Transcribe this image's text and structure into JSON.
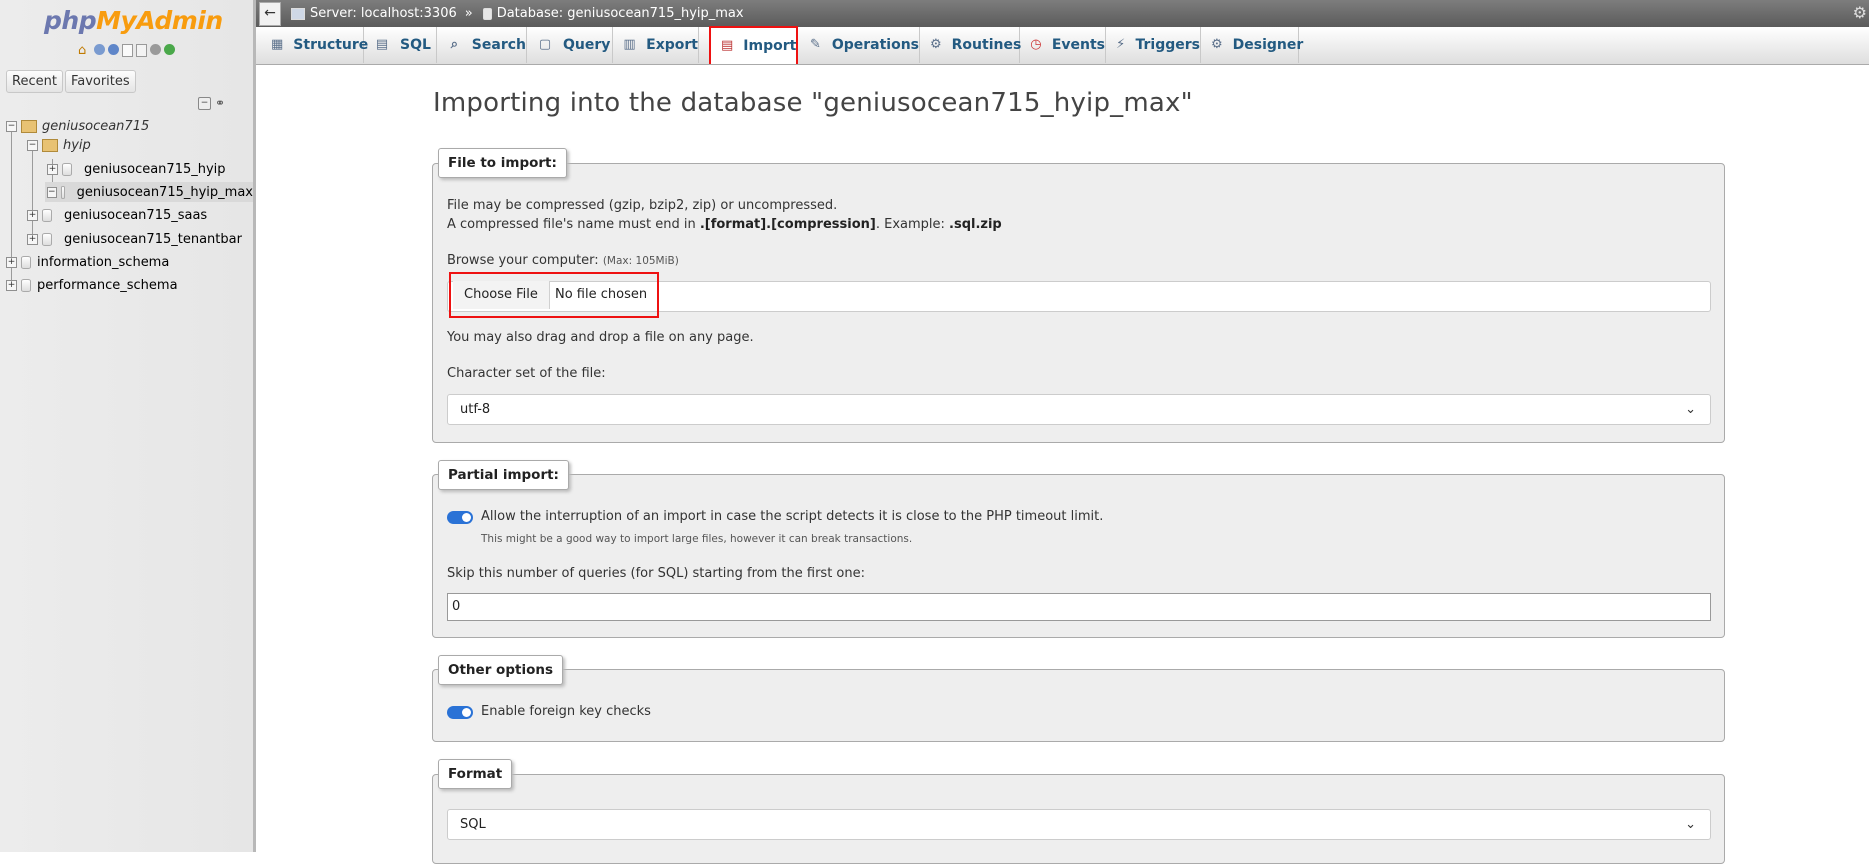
{
  "sidebar": {
    "logo_php": "php",
    "logo_myadmin": "MyAdmin",
    "tabs": [
      "Recent",
      "Favorites"
    ],
    "tree": [
      {
        "label": "geniusocean715",
        "italic": true
      },
      {
        "label": "hyip",
        "italic": true
      },
      {
        "label": "geniusocean715_hyip"
      },
      {
        "label": "geniusocean715_hyip_max"
      },
      {
        "label": "geniusocean715_saas"
      },
      {
        "label": "geniusocean715_tenantbar"
      },
      {
        "label": "information_schema"
      },
      {
        "label": "performance_schema"
      }
    ]
  },
  "topbar": {
    "server": "Server: localhost:3306",
    "separator": "»",
    "database": "Database: geniusocean715_hyip_max"
  },
  "tabs": [
    {
      "label": "Structure",
      "icon": "structure-icon"
    },
    {
      "label": "SQL",
      "icon": "sql-icon"
    },
    {
      "label": "Search",
      "icon": "search-icon"
    },
    {
      "label": "Query",
      "icon": "query-icon"
    },
    {
      "label": "Export",
      "icon": "export-icon"
    },
    {
      "label": "Import",
      "icon": "import-icon",
      "active": true
    },
    {
      "label": "Operations",
      "icon": "wrench-icon"
    },
    {
      "label": "Routines",
      "icon": "routines-icon"
    },
    {
      "label": "Events",
      "icon": "clock-icon"
    },
    {
      "label": "Triggers",
      "icon": "triggers-icon"
    },
    {
      "label": "Designer",
      "icon": "designer-icon"
    }
  ],
  "main": {
    "title": "Importing into the database \"geniusocean715_hyip_max\"",
    "file_import": {
      "legend": "File to import:",
      "line1": "File may be compressed (gzip, bzip2, zip) or uncompressed.",
      "line2_prefix": "A compressed file's name must end in ",
      "line2_bold": ".[format].[compression]",
      "line2_mid": ". Example: ",
      "line2_example": ".sql.zip",
      "browse_label": "Browse your computer:",
      "max_size": "(Max: 105MiB)",
      "choose_file": "Choose File",
      "no_file": "No file chosen",
      "drag_drop": "You may also drag and drop a file on any page.",
      "charset_label": "Character set of the file:",
      "charset_value": "utf-8"
    },
    "partial_import": {
      "legend": "Partial import:",
      "allow_interrupt": "Allow the interruption of an import in case the script detects it is close to the PHP timeout limit.",
      "allow_interrupt_enabled": true,
      "hint": "This might be a good way to import large files, however it can break transactions.",
      "skip_label": "Skip this number of queries (for SQL) starting from the first one:",
      "skip_value": "0"
    },
    "other_options": {
      "legend": "Other options",
      "foreign_key_checks": "Enable foreign key checks",
      "foreign_key_checks_enabled": true
    },
    "format": {
      "legend": "Format",
      "value": "SQL"
    }
  },
  "colors": {
    "tab_text": "#235a81",
    "highlight_border": "#e11111",
    "toggle_on": "#2a72d6"
  }
}
